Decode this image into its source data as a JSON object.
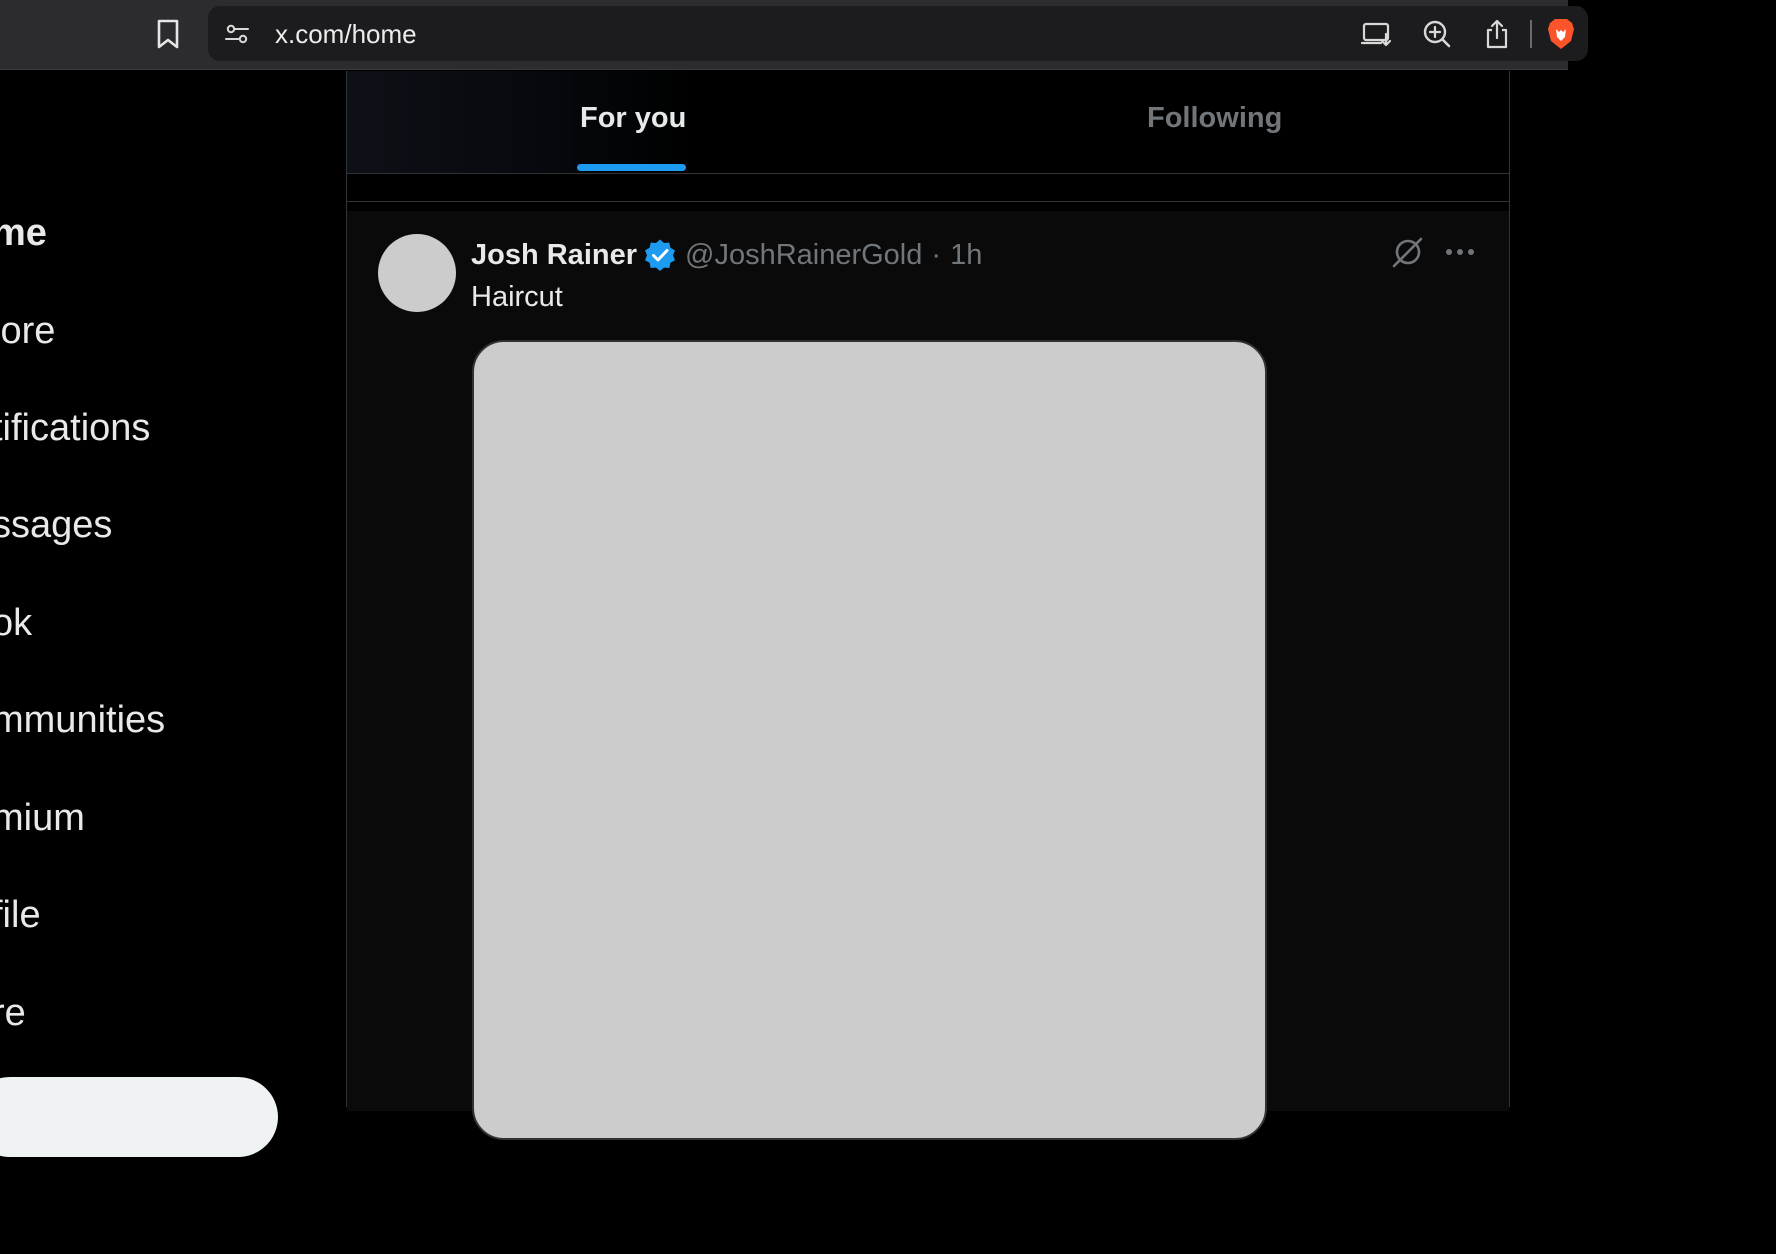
{
  "browser": {
    "url": "x.com/home",
    "icons": {
      "bookmark": "bookmark-icon",
      "site_settings": "site-settings-icon",
      "cast": "cast-to-device-icon",
      "zoom": "zoom-in-icon",
      "share": "share-icon",
      "brave": "brave-lion-icon"
    }
  },
  "nav": {
    "items": [
      {
        "label": "me",
        "active": true
      },
      {
        "label": "lore",
        "active": false
      },
      {
        "label": "tifications",
        "active": false
      },
      {
        "label": "ssages",
        "active": false
      },
      {
        "label": "ok",
        "active": false
      },
      {
        "label": "mmunities",
        "active": false
      },
      {
        "label": "mium",
        "active": false
      },
      {
        "label": "file",
        "active": false
      },
      {
        "label": "re",
        "active": false
      }
    ]
  },
  "tabs": [
    {
      "label": "For you",
      "selected": true
    },
    {
      "label": "Following",
      "selected": false
    }
  ],
  "post": {
    "author_name": "Josh Rainer",
    "author_handle": "@JoshRainerGold",
    "separator": "·",
    "time": "1h",
    "verified": true,
    "text": "Haircut",
    "icons": {
      "verified": "verified-badge-icon",
      "grok": "grok-icon",
      "more": "more-options-icon"
    }
  },
  "colors": {
    "accent": "#1d9bf0",
    "background": "#000000",
    "post_background": "#0a0a0a",
    "text_primary": "#e7e9ea",
    "text_secondary": "#71767b",
    "placeholder": "#cccccc"
  }
}
